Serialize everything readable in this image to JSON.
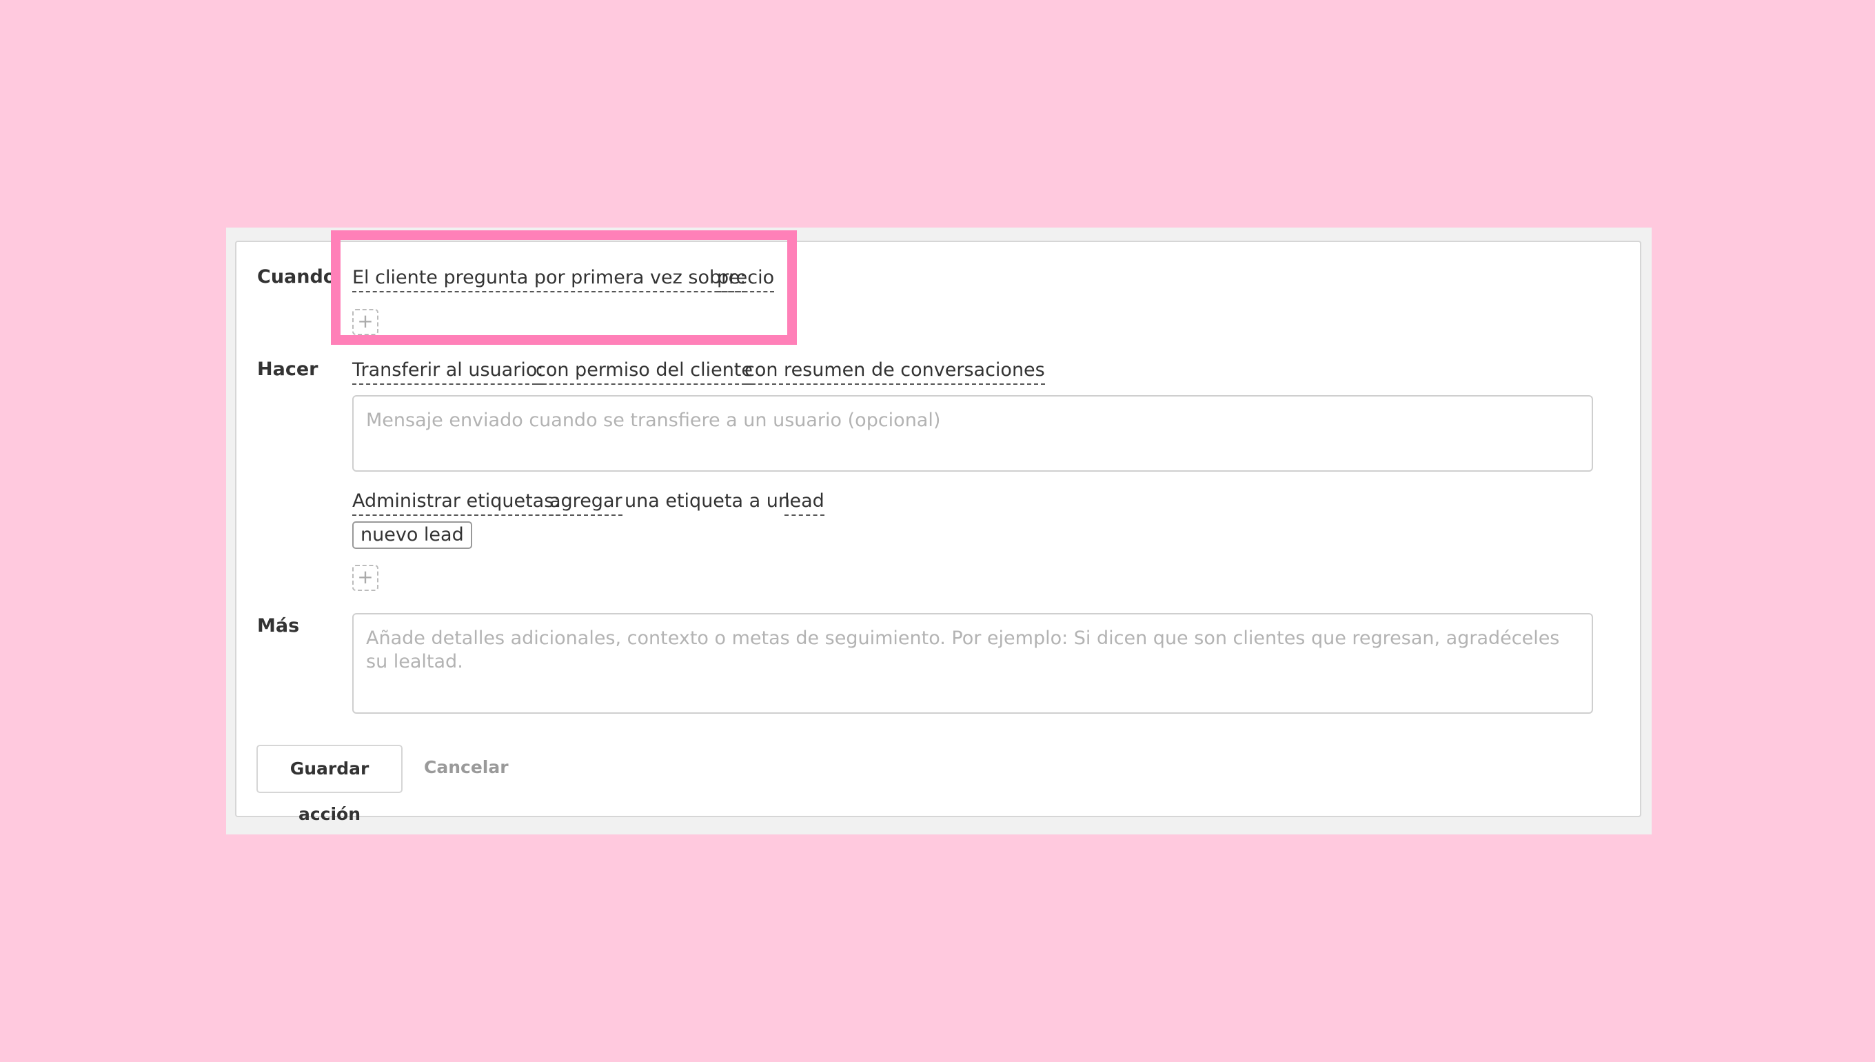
{
  "rule": {
    "when": {
      "label": "Cuando",
      "trigger_label": "El cliente pregunta por primera vez sobre:",
      "trigger_value": "precio",
      "add_icon": "plus-icon"
    },
    "do": {
      "label": "Hacer",
      "transfer_label": "Transferir al usuario:",
      "transfer_option_1": "con permiso del cliente",
      "transfer_option_2": "con resumen de conversaciones",
      "transfer_message_placeholder": "Mensaje enviado cuando se transfiere a un usuario (opcional)",
      "tags_label": "Administrar etiquetas:",
      "tags_action": "agregar",
      "tags_connector": "una etiqueta a un",
      "tags_target": "lead",
      "tag_value": "nuevo lead",
      "add_icon": "plus-icon"
    },
    "more": {
      "label": "Más",
      "placeholder": "Añade detalles adicionales, contexto o metas de seguimiento. Por ejemplo: Si dicen que son clientes que regresan, agradéceles su lealtad."
    }
  },
  "actions": {
    "save_label": "Guardar acción",
    "cancel_label": "Cancelar"
  },
  "colors": {
    "background": "#ffc9de",
    "highlight": "#ff80b8"
  }
}
